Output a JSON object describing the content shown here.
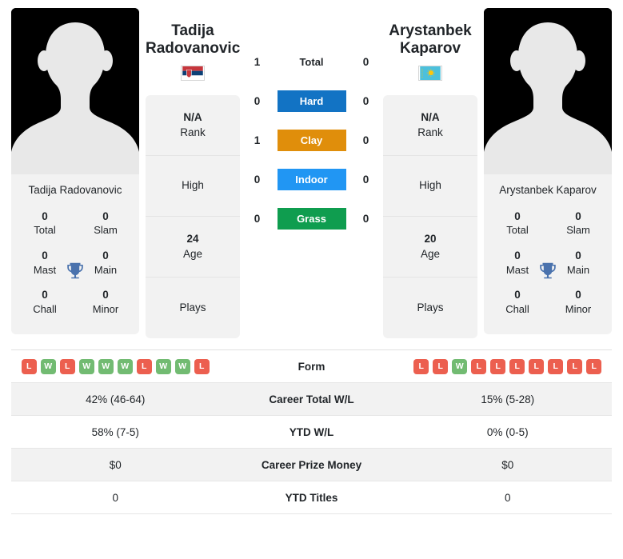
{
  "players": {
    "left": {
      "first_name": "Tadija",
      "last_name": "Radovanovic",
      "full_name": "Tadija Radovanovic",
      "flag": "serbia-flag",
      "rank_value": "N/A",
      "rank_label": "Rank",
      "high_label": "High",
      "age_value": "24",
      "age_label": "Age",
      "plays_label": "Plays",
      "trophies": {
        "total_num": "0",
        "total_lbl": "Total",
        "slam_num": "0",
        "slam_lbl": "Slam",
        "mast_num": "0",
        "mast_lbl": "Mast",
        "main_num": "0",
        "main_lbl": "Main",
        "chall_num": "0",
        "chall_lbl": "Chall",
        "minor_num": "0",
        "minor_lbl": "Minor"
      },
      "form": [
        "L",
        "W",
        "L",
        "W",
        "W",
        "W",
        "L",
        "W",
        "W",
        "L"
      ],
      "career_wl": "42% (46-64)",
      "ytd_wl": "58% (7-5)",
      "career_prize": "$0",
      "ytd_titles": "0"
    },
    "right": {
      "first_name": "Arystanbek",
      "last_name": "Kaparov",
      "full_name": "Arystanbek Kaparov",
      "flag": "kazakhstan-flag",
      "rank_value": "N/A",
      "rank_label": "Rank",
      "high_label": "High",
      "age_value": "20",
      "age_label": "Age",
      "plays_label": "Plays",
      "trophies": {
        "total_num": "0",
        "total_lbl": "Total",
        "slam_num": "0",
        "slam_lbl": "Slam",
        "mast_num": "0",
        "mast_lbl": "Mast",
        "main_num": "0",
        "main_lbl": "Main",
        "chall_num": "0",
        "chall_lbl": "Chall",
        "minor_num": "0",
        "minor_lbl": "Minor"
      },
      "form": [
        "L",
        "L",
        "W",
        "L",
        "L",
        "L",
        "L",
        "L",
        "L",
        "L"
      ],
      "career_wl": "15% (5-28)",
      "ytd_wl": "0% (0-5)",
      "career_prize": "$0",
      "ytd_titles": "0"
    }
  },
  "head_to_head": [
    {
      "label": "Total",
      "left": "1",
      "right": "0",
      "color": "",
      "pill": false
    },
    {
      "label": "Hard",
      "left": "0",
      "right": "0",
      "color": "#1273c4",
      "pill": true
    },
    {
      "label": "Clay",
      "left": "1",
      "right": "0",
      "color": "#e08e0b",
      "pill": true
    },
    {
      "label": "Indoor",
      "left": "0",
      "right": "0",
      "color": "#2196f3",
      "pill": true
    },
    {
      "label": "Grass",
      "left": "0",
      "right": "0",
      "color": "#0f9d4f",
      "pill": true
    }
  ],
  "stats_rows": [
    {
      "label": "Form",
      "key": "form",
      "type": "form"
    },
    {
      "label": "Career Total W/L",
      "key": "career_wl",
      "type": "text"
    },
    {
      "label": "YTD W/L",
      "key": "ytd_wl",
      "type": "text"
    },
    {
      "label": "Career Prize Money",
      "key": "career_prize",
      "type": "text"
    },
    {
      "label": "YTD Titles",
      "key": "ytd_titles",
      "type": "text"
    }
  ],
  "colors": {
    "win": "#72bb72",
    "loss": "#ec5f4f",
    "panel": "#f2f2f2",
    "trophy": "#4a72ad"
  }
}
